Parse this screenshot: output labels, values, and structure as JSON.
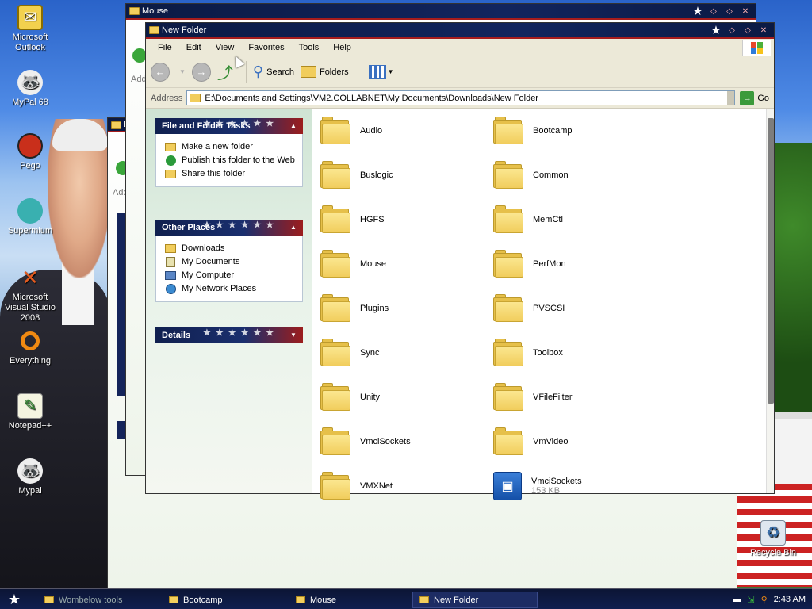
{
  "desktop": {
    "icons": [
      {
        "label": "Microsoft Outlook",
        "icon": "outlook-icon"
      },
      {
        "label": "MyPal 68",
        "icon": "mypal-icon"
      },
      {
        "label": "Pego",
        "icon": "pego-icon"
      },
      {
        "label": "Supermium",
        "icon": "supermium-icon"
      },
      {
        "label": "Microsoft Visual Studio 2008",
        "icon": "visual-studio-icon"
      },
      {
        "label": "Everything",
        "icon": "everything-icon"
      },
      {
        "label": "Notepad++",
        "icon": "notepadpp-icon"
      },
      {
        "label": "Mypal",
        "icon": "mypal-icon"
      },
      {
        "label": "Recycle Bin",
        "icon": "recycle-bin-icon"
      }
    ]
  },
  "bg_windows": {
    "mouse_title": "Mouse",
    "bootcamp_title": "B",
    "address_label_short": "Add"
  },
  "window": {
    "title": "New Folder",
    "menu": [
      "File",
      "Edit",
      "View",
      "Favorites",
      "Tools",
      "Help"
    ],
    "toolbar": {
      "back": "",
      "search": "Search",
      "folders": "Folders"
    },
    "address": {
      "label": "Address",
      "value": "E:\\Documents and Settings\\VM2.COLLABNET\\My Documents\\Downloads\\New Folder",
      "go": "Go"
    },
    "tasks_panel": {
      "title": "File and Folder Tasks",
      "items": [
        "Make a new folder",
        "Publish this folder to the Web",
        "Share this folder"
      ]
    },
    "places_panel": {
      "title": "Other Places",
      "items": [
        "Downloads",
        "My Documents",
        "My Computer",
        "My Network Places"
      ]
    },
    "details_panel": {
      "title": "Details"
    },
    "files": [
      {
        "name": "Audio",
        "type": "folder"
      },
      {
        "name": "Bootcamp",
        "type": "folder"
      },
      {
        "name": "Buslogic",
        "type": "folder"
      },
      {
        "name": "Common",
        "type": "folder"
      },
      {
        "name": "HGFS",
        "type": "folder"
      },
      {
        "name": "MemCtl",
        "type": "folder"
      },
      {
        "name": "Mouse",
        "type": "folder"
      },
      {
        "name": "PerfMon",
        "type": "folder"
      },
      {
        "name": "Plugins",
        "type": "folder"
      },
      {
        "name": "PVSCSI",
        "type": "folder"
      },
      {
        "name": "Sync",
        "type": "folder"
      },
      {
        "name": "Toolbox",
        "type": "folder"
      },
      {
        "name": "Unity",
        "type": "folder"
      },
      {
        "name": "VFileFilter",
        "type": "folder"
      },
      {
        "name": "VmciSockets",
        "type": "folder"
      },
      {
        "name": "VmVideo",
        "type": "folder"
      },
      {
        "name": "VMXNet",
        "type": "folder"
      },
      {
        "name": "VmciSockets",
        "type": "file",
        "size": "153 KB"
      }
    ]
  },
  "taskbar": {
    "tasks": [
      "Wombelow tools",
      "Bootcamp",
      "Mouse",
      "New Folder"
    ],
    "active": "New Folder",
    "clock": "2:43 AM"
  },
  "colors": {
    "title_bar": "#0b1a44",
    "accent_red": "#a61c1c",
    "menu_bg": "#ece9d8",
    "folder": "#f1cd5c"
  }
}
